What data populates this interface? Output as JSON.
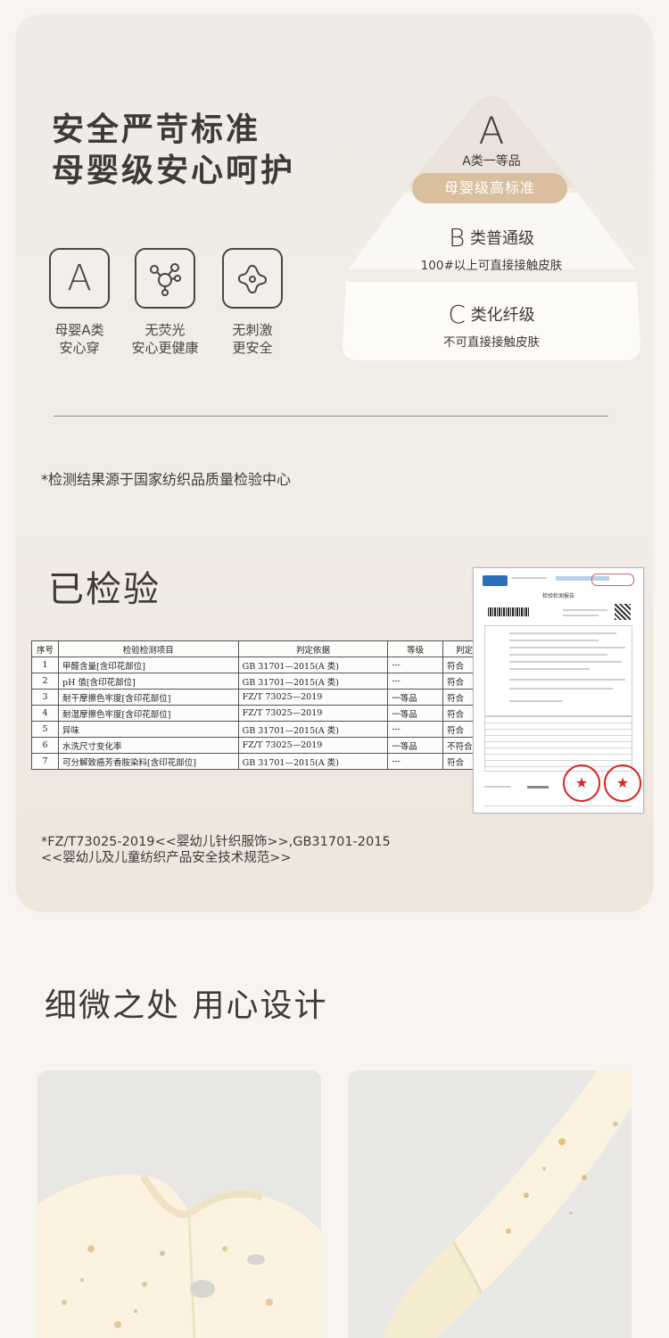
{
  "headline": {
    "line1": "安全严苛标准",
    "line2": "母婴级安心呵护"
  },
  "features": [
    {
      "icon": "letter-a-icon",
      "glyph": "A",
      "line1": "母婴A类",
      "line2": "安心穿"
    },
    {
      "icon": "molecule-icon",
      "line1": "无荧光",
      "line2": "安心更健康"
    },
    {
      "icon": "no-irritation-icon",
      "line1": "无刺激",
      "line2": "更安全"
    }
  ],
  "pyramid": {
    "a_letter": "A",
    "a_label": "A类一等品",
    "a_badge": "母婴级高标准",
    "b_letter": "B",
    "b_label": "类普通级",
    "b_desc": "100#以上可直接接触皮肤",
    "c_letter": "C",
    "c_label": "类化纤级",
    "c_desc": "不可直接接触皮肤"
  },
  "source_note": "*检测结果源于国家纺织品质量检验中心",
  "checked_title": "已检验",
  "inspection": {
    "headers": [
      "序号",
      "检验检测项目",
      "判定依据",
      "等级",
      "判定"
    ],
    "rows": [
      [
        "1",
        "甲醛含量[含印花部位]",
        "GB 31701—2015(A 类)",
        "---",
        "符合"
      ],
      [
        "2",
        "pH 值[含印花部位]",
        "GB 31701—2015(A 类)",
        "---",
        "符合"
      ],
      [
        "3",
        "耐干摩擦色牢度[含印花部位]",
        "FZ/T 73025—2019",
        "一等品",
        "符合"
      ],
      [
        "4",
        "耐湿摩擦色牢度[含印花部位]",
        "FZ/T 73025—2019",
        "一等品",
        "符合"
      ],
      [
        "5",
        "异味",
        "GB 31701—2015(A 类)",
        "---",
        "符合"
      ],
      [
        "6",
        "水洗尺寸变化率",
        "FZ/T 73025—2019",
        "一等品",
        "不符合"
      ],
      [
        "7",
        "可分解致癌芳香胺染料[含印花部位]",
        "GB 31701—2015(A 类)",
        "---",
        "符合"
      ]
    ]
  },
  "standards_note": {
    "line1": "*FZ/T73025-2019<<婴幼儿针织服饰>>,GB31701-2015",
    "line2": "<<婴幼儿及儿童纺织产品安全技术规范>>"
  },
  "report": {
    "title": "检验检测报告"
  },
  "design_title": "细微之处 用心设计",
  "colors": {
    "accent": "#d9bf9d",
    "card_bg": "#efebe6",
    "text": "#3f3a36"
  }
}
